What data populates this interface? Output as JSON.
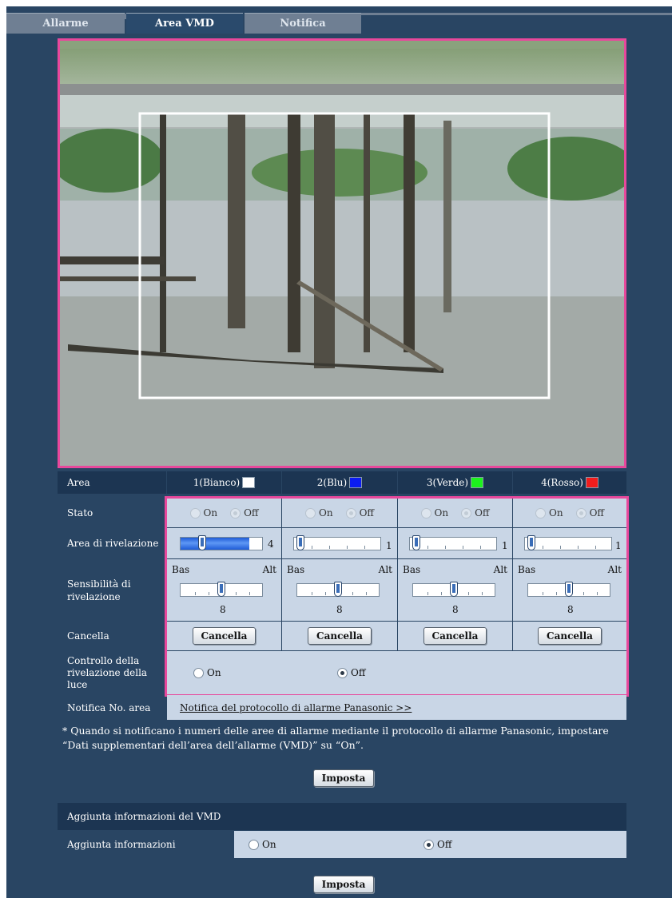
{
  "tabs": [
    {
      "label": "Allarme"
    },
    {
      "label": "Area VMD"
    },
    {
      "label": "Notifica"
    }
  ],
  "colors": {
    "accent_pink": "#e8489c",
    "background": "#294563",
    "header": "#1c3552",
    "light_cell": "#c9d6e6"
  },
  "areas": {
    "row_label": "Area",
    "columns": [
      {
        "label": "1(Bianco)",
        "color": "#ffffff"
      },
      {
        "label": "2(Blu)",
        "color": "#0b1cf2"
      },
      {
        "label": "3(Verde)",
        "color": "#1df21d"
      },
      {
        "label": "4(Rosso)",
        "color": "#f21d1d"
      }
    ]
  },
  "stato": {
    "label": "Stato",
    "on": "On",
    "off": "Off",
    "selected": [
      "Off",
      "Off",
      "Off",
      "Off"
    ]
  },
  "area_rivelazione": {
    "label": "Area di rivelazione",
    "values": [
      "4",
      "1",
      "1",
      "1"
    ]
  },
  "sensibilita": {
    "label": "Sensibilità di rivelazione",
    "low": "Bas",
    "high": "Alt",
    "values": [
      "8",
      "8",
      "8",
      "8"
    ]
  },
  "cancella": {
    "label": "Cancella",
    "button": "Cancella"
  },
  "controllo_luce": {
    "label": "Controllo della rivelazione della luce",
    "on": "On",
    "off": "Off",
    "selected": "Off"
  },
  "notifica_area": {
    "label": "Notifica No. area",
    "link": "Notifica del protocollo di allarme Panasonic >>"
  },
  "note": {
    "line1": "* Quando si notificano i numeri delle aree di allarme mediante il protocollo di allarme Panasonic, impostare",
    "line2": "“Dati supplementari dell’area dell’allarme (VMD)” su “On”."
  },
  "imposta_label": "Imposta",
  "vmd_info": {
    "section_title": "Aggiunta informazioni del VMD",
    "row_label": "Aggiunta informazioni",
    "on": "On",
    "off": "Off",
    "selected": "Off"
  }
}
